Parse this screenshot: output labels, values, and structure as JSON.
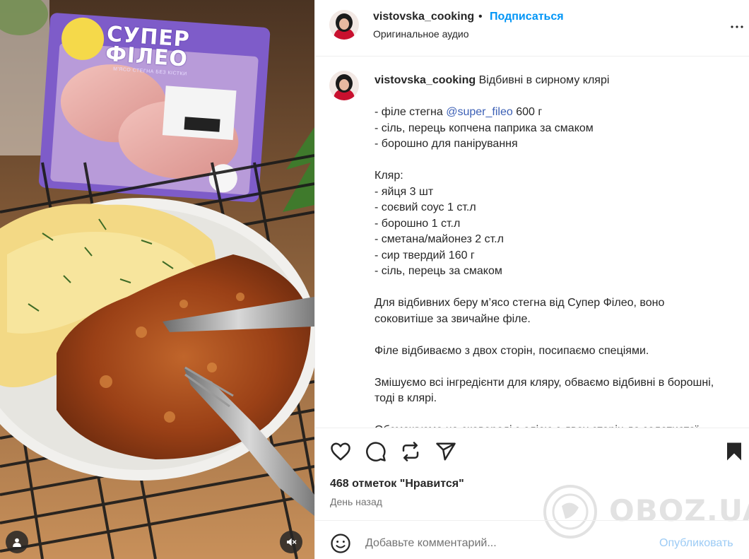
{
  "media": {
    "package_brand": "СУПЕР ФІЛЕО",
    "package_subtitle": "М'ЯСО СТЕГНА БЕЗ КІСТКИ",
    "logo_text": "ЯКО-ЙО",
    "buttons": {
      "tag_icon": "user-icon",
      "mute_icon": "mute-icon"
    }
  },
  "header": {
    "username": "vistovska_cooking",
    "dot": "•",
    "follow_label": "Подписаться",
    "audio_label": "Оригинальное аудио"
  },
  "caption": {
    "username": "vistovska_cooking",
    "text_before_mention": " Відбивні в сирному клярі\n\n- філе стегна ",
    "mention": "@super_fileo",
    "text_after_mention": " 600 г\n- сіль, перець копчена паприка за смаком\n- борошно для панірування\n\nКляр:\n- яйця 3 шт\n- соєвий соус 1 ст.л\n- борошно 1 ст.л\n- сметана/майонез 2 ст.л\n- сир твердий 160 г\n- сіль, перець за смаком\n\nДля відбивних беру м’ясо стегна від Супер Філео, воно соковитіше за звичайне філе.\n\nФіле відбиваємо з двох сторін, посипаємо спеціями.\n\nЗмішуємо всі інгредієнти для кляру, обваємо відбивні в борошні, тоді в клярі.\n\nОбсмажуємо на сковороді з олією з двох сторін до золотистої скоринки."
  },
  "actions": {
    "icons": [
      "heart-icon",
      "comment-icon",
      "repost-icon",
      "share-icon",
      "bookmark-icon"
    ]
  },
  "likes_label": "468 отметок \"Нравится\"",
  "time_label": "День назад",
  "comment": {
    "placeholder": "Добавьте комментарий...",
    "post_label": "Опубликовать"
  },
  "watermark": "OBOZ.UA",
  "colors": {
    "accent": "#0095f6",
    "post_disabled": "#9ccbf5",
    "mention": "#3b5fb5",
    "border": "#efefef"
  }
}
